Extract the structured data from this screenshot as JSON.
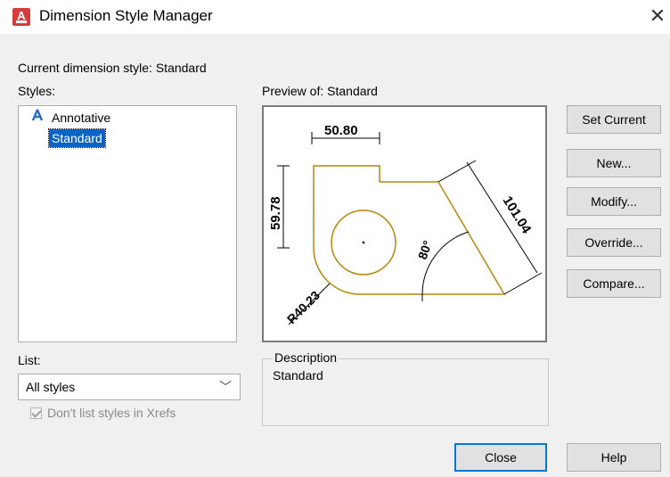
{
  "window": {
    "title": "Dimension Style Manager",
    "icon": "autocad-icon",
    "close_glyph": "✕"
  },
  "current_style_label": "Current dimension style: Standard",
  "styles": {
    "label": "Styles:",
    "items": [
      {
        "name": "Annotative",
        "icon": "annotative-icon",
        "selected": false
      },
      {
        "name": "Standard",
        "selected": true
      }
    ]
  },
  "preview": {
    "label": "Preview of: Standard",
    "dims": {
      "width": "50.80",
      "height": "59.78",
      "diagonal": "101.04",
      "angle": "80°",
      "radius": "R40.23"
    },
    "colors": {
      "geometry": "#b8860b",
      "dimension": "#000000"
    }
  },
  "list": {
    "label": "List:",
    "selected": "All styles",
    "chevron": "﹀"
  },
  "dont_list_xrefs": {
    "label": "Don't list styles in Xrefs",
    "checked": true,
    "disabled": true
  },
  "description": {
    "title": "Description",
    "text": "Standard"
  },
  "buttons": {
    "set_current": "Set Current",
    "new": "New...",
    "modify": "Modify...",
    "override": "Override...",
    "compare": "Compare...",
    "close": "Close",
    "help": "Help"
  }
}
